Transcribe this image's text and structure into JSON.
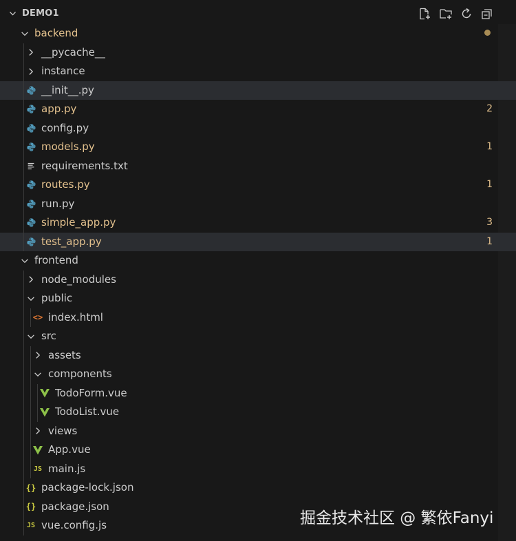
{
  "header": {
    "title": "DEMO1",
    "actions": [
      "new-file-icon",
      "new-folder-icon",
      "refresh-icon",
      "collapse-all-icon"
    ]
  },
  "tree": [
    {
      "label": "backend",
      "type": "folder-open",
      "depth": 0,
      "modified": true
    },
    {
      "label": "__pycache__",
      "type": "folder",
      "depth": 1
    },
    {
      "label": "instance",
      "type": "folder",
      "depth": 1
    },
    {
      "label": "__init__.py",
      "type": "python",
      "depth": 1,
      "state": "hover"
    },
    {
      "label": "app.py",
      "type": "python",
      "depth": 1,
      "modified": true,
      "badge": "2"
    },
    {
      "label": "config.py",
      "type": "python",
      "depth": 1
    },
    {
      "label": "models.py",
      "type": "python",
      "depth": 1,
      "modified": true,
      "badge": "1"
    },
    {
      "label": "requirements.txt",
      "type": "text",
      "depth": 1
    },
    {
      "label": "routes.py",
      "type": "python",
      "depth": 1,
      "modified": true,
      "badge": "1"
    },
    {
      "label": "run.py",
      "type": "python",
      "depth": 1
    },
    {
      "label": "simple_app.py",
      "type": "python",
      "depth": 1,
      "modified": true,
      "badge": "3"
    },
    {
      "label": "test_app.py",
      "type": "python",
      "depth": 1,
      "modified": true,
      "badge": "1",
      "state": "selected"
    },
    {
      "label": "frontend",
      "type": "folder-open",
      "depth": 0
    },
    {
      "label": "node_modules",
      "type": "folder",
      "depth": 1
    },
    {
      "label": "public",
      "type": "folder-open",
      "depth": 1
    },
    {
      "label": "index.html",
      "type": "html",
      "depth": 2
    },
    {
      "label": "src",
      "type": "folder-open",
      "depth": 1
    },
    {
      "label": "assets",
      "type": "folder",
      "depth": 2
    },
    {
      "label": "components",
      "type": "folder-open",
      "depth": 2
    },
    {
      "label": "TodoForm.vue",
      "type": "vue",
      "depth": 3
    },
    {
      "label": "TodoList.vue",
      "type": "vue",
      "depth": 3
    },
    {
      "label": "views",
      "type": "folder",
      "depth": 2
    },
    {
      "label": "App.vue",
      "type": "vue",
      "depth": 2
    },
    {
      "label": "main.js",
      "type": "js",
      "depth": 2
    },
    {
      "label": "package-lock.json",
      "type": "json",
      "depth": 1
    },
    {
      "label": "package.json",
      "type": "json",
      "depth": 1
    },
    {
      "label": "vue.config.js",
      "type": "js",
      "depth": 1
    }
  ],
  "icon_glyphs": {
    "json": "{}",
    "js": "JS",
    "html": "<>"
  },
  "watermark": "掘金技术社区 @ 繁依Fanyi",
  "colors": {
    "background": "#181818",
    "text": "#cccccc",
    "modified": "#e2c08d",
    "selected_row": "#2b2d31",
    "python_icon": "#519aba",
    "vue_icon": "#8dc149",
    "js_icon": "#cbcb41"
  }
}
